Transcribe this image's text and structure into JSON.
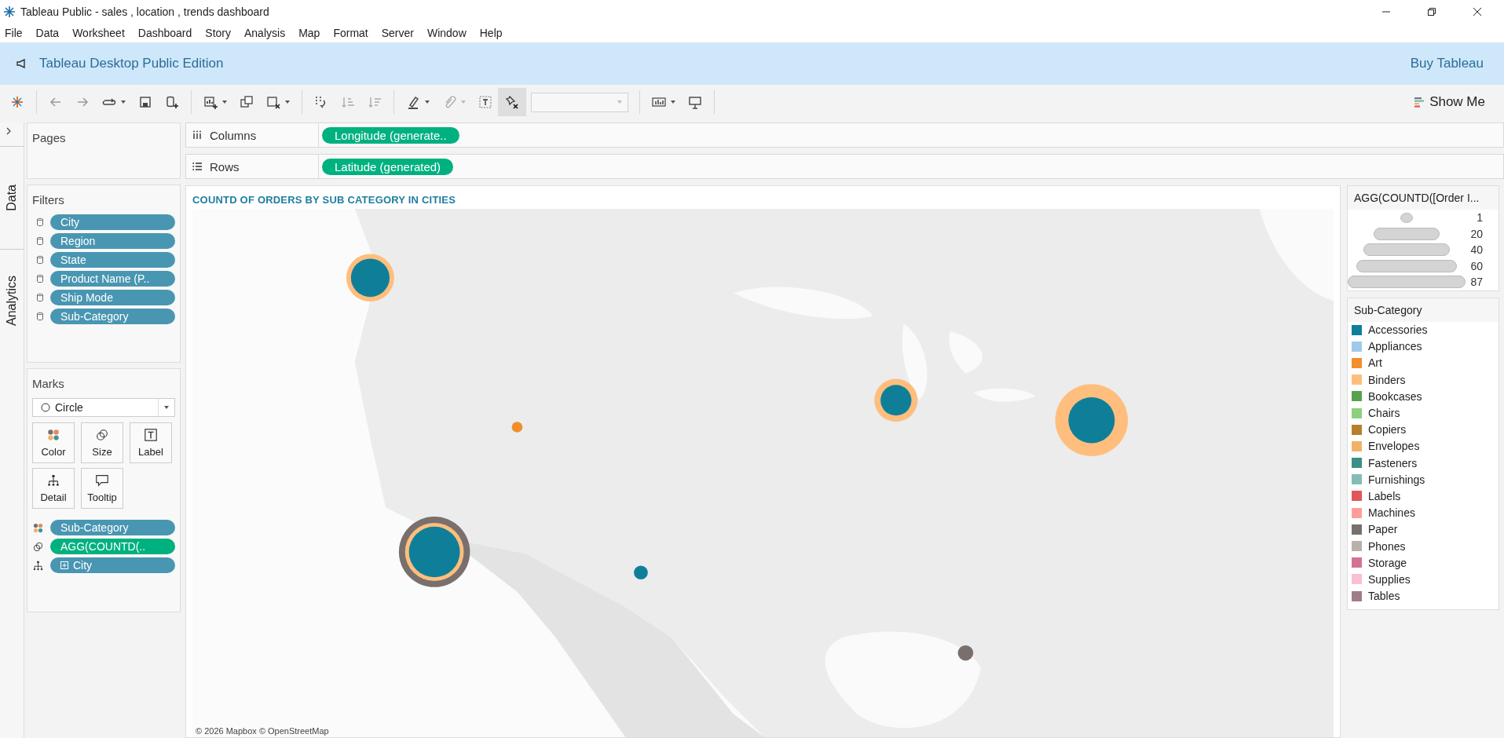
{
  "window": {
    "title": "Tableau Public - sales , location , trends dashboard"
  },
  "menu": [
    "File",
    "Data",
    "Worksheet",
    "Dashboard",
    "Story",
    "Analysis",
    "Map",
    "Format",
    "Server",
    "Window",
    "Help"
  ],
  "banner": {
    "text": "Tableau Desktop Public Edition",
    "link": "Buy Tableau"
  },
  "toolbar": {
    "show_me": "Show Me"
  },
  "side_tabs": [
    "Data",
    "Analytics"
  ],
  "pages": {
    "title": "Pages"
  },
  "filters": {
    "title": "Filters",
    "items": [
      "City",
      "Region",
      "State",
      "Product Name (P..",
      "Ship Mode",
      "Sub-Category"
    ]
  },
  "marks": {
    "title": "Marks",
    "mark_type": "Circle",
    "cards": [
      {
        "kind": "color",
        "label": "Color"
      },
      {
        "kind": "size",
        "label": "Size"
      },
      {
        "kind": "label",
        "label": "Label"
      },
      {
        "kind": "detail",
        "label": "Detail"
      },
      {
        "kind": "tooltip",
        "label": "Tooltip"
      }
    ],
    "fields": [
      {
        "kind": "color",
        "label": "Sub-Category",
        "continuous": false
      },
      {
        "kind": "size",
        "label": "AGG(COUNTD(..",
        "continuous": true
      },
      {
        "kind": "detail",
        "label": "City",
        "continuous": false
      }
    ]
  },
  "shelves": [
    {
      "kind": "columns",
      "label": "Columns",
      "pill": "Longitude (generate..",
      "continuous": true
    },
    {
      "kind": "rows",
      "label": "Rows",
      "pill": "Latitude (generated)",
      "continuous": true
    }
  ],
  "view": {
    "title": "COUNTD OF ORDERS BY SUB CATEGORY IN CITIES",
    "attribution": "© 2026 Mapbox © OpenStreetMap"
  },
  "size_legend": {
    "title": "AGG(COUNTD([Order I...",
    "items": [
      "1",
      "20",
      "40",
      "60",
      "87"
    ]
  },
  "color_legend": {
    "title": "Sub-Category",
    "items": [
      {
        "label": "Accessories",
        "color": "#0f7f99"
      },
      {
        "label": "Appliances",
        "color": "#9fcbe8"
      },
      {
        "label": "Art",
        "color": "#f28e2b"
      },
      {
        "label": "Binders",
        "color": "#ffbe7d"
      },
      {
        "label": "Bookcases",
        "color": "#59a14f"
      },
      {
        "label": "Chairs",
        "color": "#8cd17d"
      },
      {
        "label": "Copiers",
        "color": "#b6812d"
      },
      {
        "label": "Envelopes",
        "color": "#f1b26a"
      },
      {
        "label": "Fasteners",
        "color": "#3a8f88"
      },
      {
        "label": "Furnishings",
        "color": "#86bcb6"
      },
      {
        "label": "Labels",
        "color": "#e15759"
      },
      {
        "label": "Machines",
        "color": "#ff9d9a"
      },
      {
        "label": "Paper",
        "color": "#79706e"
      },
      {
        "label": "Phones",
        "color": "#bab0ac"
      },
      {
        "label": "Storage",
        "color": "#d37295"
      },
      {
        "label": "Supplies",
        "color": "#fabfd2"
      },
      {
        "label": "Tables",
        "color": "#a07d86"
      }
    ]
  }
}
